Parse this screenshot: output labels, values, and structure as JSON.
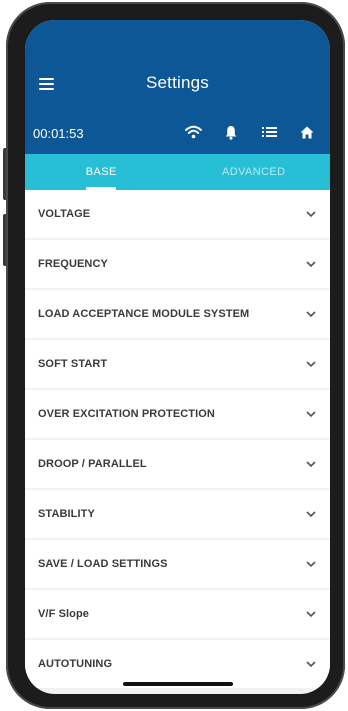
{
  "header": {
    "title": "Settings",
    "time": "00:01:53",
    "status_icons": [
      "wifi-icon",
      "bell-icon",
      "list-icon",
      "home-icon"
    ],
    "background_color": "#0e5796"
  },
  "tabs": [
    {
      "label": "BASE",
      "active": true
    },
    {
      "label": "ADVANCED",
      "active": false
    }
  ],
  "tab_bar_color": "#26bfd6",
  "sections": [
    {
      "label": "VOLTAGE"
    },
    {
      "label": "FREQUENCY"
    },
    {
      "label": "LOAD ACCEPTANCE MODULE SYSTEM"
    },
    {
      "label": "SOFT START"
    },
    {
      "label": "OVER EXCITATION PROTECTION"
    },
    {
      "label": "DROOP / PARALLEL"
    },
    {
      "label": "STABILITY"
    },
    {
      "label": "SAVE / LOAD SETTINGS"
    },
    {
      "label": "V/F Slope"
    },
    {
      "label": "AUTOTUNING"
    }
  ]
}
